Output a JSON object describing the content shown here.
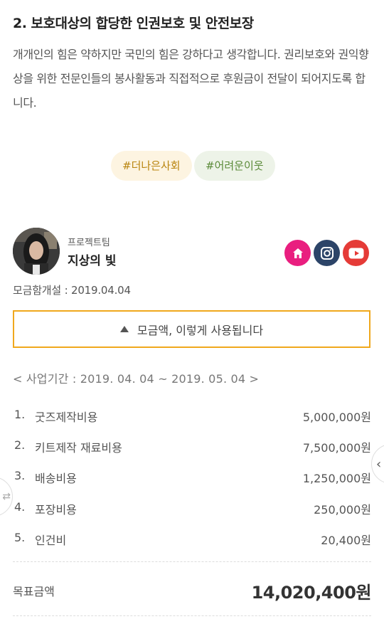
{
  "section": {
    "title": "2. 보호대상의 합당한 인권보호 및 안전보장",
    "body": "개개인의 힘은 약하지만 국민의 힘은 강하다고 생각합니다. 권리보호와 권익향상을 위한 전문인들의 봉사활동과 직접적으로 후원금이 전달이 되어지도록 합니다."
  },
  "tags": [
    "#더나은사회",
    "#어려운이웃"
  ],
  "team": {
    "label": "프로젝트팀",
    "name": "지상의 빛",
    "social_icons": [
      "home-icon",
      "instagram-icon",
      "youtube-icon"
    ],
    "social_colors": [
      "#e91e7f",
      "#2c4468",
      "#e53b37"
    ]
  },
  "fund": {
    "opened": "모금함개설 : 2019.04.04",
    "usage_button": "모금액, 이렇게 사용됩니다",
    "period": "< 사업기간 : 2019. 04. 04 ~ 2019. 05. 04 >",
    "items": [
      {
        "num": "1.",
        "name": "굿즈제작비용",
        "amount": "5,000,000원"
      },
      {
        "num": "2.",
        "name": "키트제작 재료비용",
        "amount": "7,500,000원"
      },
      {
        "num": "3.",
        "name": "배송비용",
        "amount": "1,250,000원"
      },
      {
        "num": "4.",
        "name": "포장비용",
        "amount": "250,000원"
      },
      {
        "num": "5.",
        "name": "인건비",
        "amount": "20,400원"
      }
    ],
    "total_label": "목표금액",
    "total_amount": "14,020,400원"
  },
  "nav": {
    "left_icon": "swap-icon",
    "right_icon": "chevron-left-icon"
  },
  "accent_color": "#f0a81d"
}
